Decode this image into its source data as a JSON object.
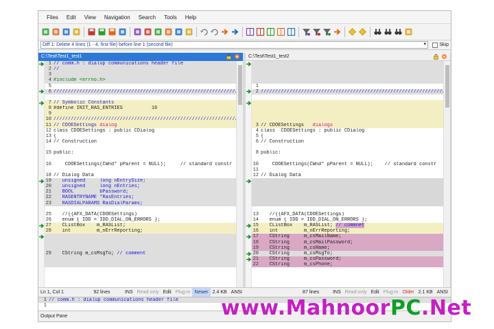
{
  "menu": [
    "Files",
    "Edit",
    "View",
    "Navigation",
    "Search",
    "Tools",
    "Help"
  ],
  "toolbar_icons": [
    "new-session-icon",
    "refresh-icon",
    "open-folder-icon",
    "open-file-icon",
    "sep",
    "save-icon",
    "save-left-icon",
    "save-right-icon",
    "find-icon",
    "sep",
    "edit-icon",
    "edit-right-icon",
    "text-icon",
    "copy-text-icon",
    "print-icon",
    "zoom-icon",
    "sep",
    "undo-icon",
    "redo-icon",
    "merge-right-icon",
    "merge-left-icon",
    "sep",
    "view-left-icon",
    "view-right-icon",
    "view-both-icon",
    "view-grid-icon",
    "view-diff-icon",
    "sep",
    "filter-icon",
    "filter-left-icon",
    "filter-right-icon",
    "up-arrow-icon",
    "sep",
    "first-diff-icon",
    "prev-diff-icon",
    "sep",
    "binoculars-icon",
    "binoculars-next-icon",
    "binoculars-prev-icon",
    "rescan-icon"
  ],
  "diff_bar": {
    "text": "Diff 1: Delete 4 lines (1 - 4, first file) before line 1 (second file)",
    "skip_label": "Skip"
  },
  "left_pane": {
    "path": "C:\\Test\\Test1_test1",
    "lines": [
      {
        "n": "1",
        "bg": "gray",
        "parts": [
          {
            "t": "// comm.h : dialup communications header file",
            "c": "cm"
          }
        ]
      },
      {
        "n": "2",
        "bg": "gray",
        "parts": [
          {
            "t": "//",
            "c": "cm"
          }
        ]
      },
      {
        "n": "3",
        "bg": "gray",
        "parts": [
          {
            "t": "",
            "c": ""
          }
        ]
      },
      {
        "n": "4",
        "bg": "gray",
        "parts": [
          {
            "t": "#include <errno.h>",
            "c": "grn"
          }
        ]
      },
      {
        "n": "5",
        "bg": "blank",
        "parts": [
          {
            "t": "",
            "c": ""
          }
        ]
      },
      {
        "n": "6",
        "bg": "gray",
        "parts": [
          {
            "t": "//////////////////////////////////////////////////////////////////",
            "c": "cm"
          }
        ]
      },
      {
        "n": "",
        "bg": "blank",
        "parts": [
          {
            "t": "",
            "c": ""
          }
        ]
      },
      {
        "n": "7",
        "bg": "changed",
        "parts": [
          {
            "t": "// Symbolic Constants",
            "c": "cm"
          }
        ]
      },
      {
        "n": "8",
        "bg": "changed",
        "parts": [
          {
            "t": "#define INIT_RAS_ENTRIES          16",
            "c": ""
          }
        ]
      },
      {
        "n": "9",
        "bg": "changed",
        "parts": [
          {
            "t": "",
            "c": ""
          }
        ]
      },
      {
        "n": "10",
        "bg": "changed",
        "parts": [
          {
            "t": "//////////////////////////////////////////////////////////////////",
            "c": "cm"
          }
        ]
      },
      {
        "n": "11",
        "bg": "changed",
        "parts": [
          {
            "t": "// CDOESettings ",
            "c": "cm"
          },
          {
            "t": "dialog",
            "c": "mag"
          }
        ]
      },
      {
        "n": "12",
        "bg": "blank",
        "parts": [
          {
            "t": "class CDOESettings : public CDialog",
            "c": ""
          }
        ]
      },
      {
        "n": "13",
        "bg": "blank",
        "parts": [
          {
            "t": "{",
            "c": ""
          }
        ]
      },
      {
        "n": "14",
        "bg": "blank",
        "parts": [
          {
            "t": "// Construction",
            "c": ""
          }
        ]
      },
      {
        "n": "",
        "bg": "blank",
        "parts": [
          {
            "t": "",
            "c": ""
          }
        ]
      },
      {
        "n": "15",
        "bg": "blank",
        "parts": [
          {
            "t": "public:",
            "c": ""
          }
        ]
      },
      {
        "n": "",
        "bg": "blank",
        "parts": [
          {
            "t": "",
            "c": ""
          }
        ]
      },
      {
        "n": "16",
        "bg": "blank",
        "parts": [
          {
            "t": "    CDOESettings(CWnd* pParent = NULL);     // standard constr",
            "c": ""
          }
        ]
      },
      {
        "n": "",
        "bg": "blank",
        "parts": [
          {
            "t": "",
            "c": ""
          }
        ]
      },
      {
        "n": "18",
        "bg": "blank",
        "parts": [
          {
            "t": "// Dialog Data",
            "c": ""
          }
        ]
      },
      {
        "n": "19",
        "bg": "gray",
        "parts": [
          {
            "t": "   unsigned     long nEntrySize;",
            "c": "kw"
          }
        ]
      },
      {
        "n": "20",
        "bg": "gray",
        "parts": [
          {
            "t": "   unsigned     long nEntries;",
            "c": "kw"
          }
        ]
      },
      {
        "n": "21",
        "bg": "gray",
        "parts": [
          {
            "t": "   BOOL         bPassword;",
            "c": "kw"
          }
        ]
      },
      {
        "n": "22",
        "bg": "gray",
        "parts": [
          {
            "t": "   RASENTRYNAME *RasEntries;",
            "c": "kw"
          }
        ]
      },
      {
        "n": "23",
        "bg": "gray",
        "parts": [
          {
            "t": "   RASDIALPARAMS RasDialParams;",
            "c": "kw"
          }
        ]
      },
      {
        "n": "",
        "bg": "blank",
        "parts": [
          {
            "t": "",
            "c": ""
          }
        ]
      },
      {
        "n": "25",
        "bg": "blank",
        "parts": [
          {
            "t": "   //{{AFX_DATA(CDOESettings)",
            "c": ""
          }
        ]
      },
      {
        "n": "26",
        "bg": "blank",
        "parts": [
          {
            "t": "   enum { IDD = IDD_DIAL_ON_ERRORS };",
            "c": ""
          }
        ]
      },
      {
        "n": "27",
        "bg": "changed",
        "parts": [
          {
            "t": "   CListBox    m_RASList;",
            "c": ""
          }
        ]
      },
      {
        "n": "28",
        "bg": "changed",
        "parts": [
          {
            "t": "   int         m_nErrReporting;",
            "c": ""
          }
        ]
      },
      {
        "n": "",
        "bg": "gray",
        "parts": [
          {
            "t": "",
            "c": ""
          }
        ]
      },
      {
        "n": "",
        "bg": "gray",
        "parts": [
          {
            "t": "",
            "c": ""
          }
        ]
      },
      {
        "n": "",
        "bg": "gray",
        "parts": [
          {
            "t": "",
            "c": ""
          }
        ]
      },
      {
        "n": "29",
        "bg": "gray",
        "parts": [
          {
            "t": "   CString m_csMsgTo; ",
            "c": ""
          },
          {
            "t": "// comment",
            "c": "cm"
          }
        ]
      },
      {
        "n": "",
        "bg": "gray",
        "parts": [
          {
            "t": "",
            "c": ""
          }
        ]
      },
      {
        "n": "",
        "bg": "gray",
        "parts": [
          {
            "t": "",
            "c": ""
          }
        ]
      }
    ]
  },
  "right_pane": {
    "path": "C:\\Test\\Test1_test2",
    "lines": [
      {
        "n": "",
        "bg": "gray",
        "parts": [
          {
            "t": "",
            "c": ""
          }
        ]
      },
      {
        "n": "",
        "bg": "gray",
        "parts": [
          {
            "t": "",
            "c": ""
          }
        ]
      },
      {
        "n": "",
        "bg": "gray",
        "parts": [
          {
            "t": "",
            "c": ""
          }
        ]
      },
      {
        "n": "",
        "bg": "gray",
        "parts": [
          {
            "t": "",
            "c": ""
          }
        ]
      },
      {
        "n": "1",
        "bg": "blank",
        "parts": [
          {
            "t": "",
            "c": ""
          }
        ]
      },
      {
        "n": "2",
        "bg": "gray",
        "parts": [
          {
            "t": "//////////////////////////////////////////////////////////////////",
            "c": "cm"
          }
        ]
      },
      {
        "n": "",
        "bg": "blank",
        "parts": [
          {
            "t": "",
            "c": ""
          }
        ]
      },
      {
        "n": "",
        "bg": "changed",
        "parts": [
          {
            "t": "",
            "c": ""
          }
        ]
      },
      {
        "n": "",
        "bg": "changed",
        "parts": [
          {
            "t": "",
            "c": ""
          }
        ]
      },
      {
        "n": "",
        "bg": "changed",
        "parts": [
          {
            "t": "",
            "c": ""
          }
        ]
      },
      {
        "n": "",
        "bg": "changed",
        "parts": [
          {
            "t": "",
            "c": ""
          }
        ]
      },
      {
        "n": "3",
        "bg": "changed",
        "parts": [
          {
            "t": "// CDOESettings   ",
            "c": ""
          },
          {
            "t": "dialogs",
            "c": "mag"
          }
        ]
      },
      {
        "n": "4",
        "bg": "blank",
        "parts": [
          {
            "t": "class  CDOESettings : public CDialog",
            "c": ""
          }
        ]
      },
      {
        "n": "5",
        "bg": "blank",
        "parts": [
          {
            "t": "{",
            "c": ""
          }
        ]
      },
      {
        "n": "6",
        "bg": "blank",
        "parts": [
          {
            "t": "// Construction",
            "c": ""
          }
        ]
      },
      {
        "n": "",
        "bg": "blank",
        "parts": [
          {
            "t": "",
            "c": ""
          }
        ]
      },
      {
        "n": "8",
        "bg": "blank",
        "parts": [
          {
            "t": "public:",
            "c": ""
          }
        ]
      },
      {
        "n": "",
        "bg": "blank",
        "parts": [
          {
            "t": "",
            "c": ""
          }
        ]
      },
      {
        "n": "10",
        "bg": "blank",
        "parts": [
          {
            "t": "    CDOESettings(CWnd* pParent = NULL);    // standard constr",
            "c": ""
          }
        ]
      },
      {
        "n": "11",
        "bg": "blank",
        "parts": [
          {
            "t": "",
            "c": ""
          }
        ]
      },
      {
        "n": "12",
        "bg": "blank",
        "parts": [
          {
            "t": "// Dialog Data",
            "c": ""
          }
        ]
      },
      {
        "n": "",
        "bg": "del",
        "parts": [
          {
            "t": "",
            "c": ""
          }
        ]
      },
      {
        "n": "",
        "bg": "del",
        "parts": [
          {
            "t": "",
            "c": ""
          }
        ]
      },
      {
        "n": "",
        "bg": "del",
        "parts": [
          {
            "t": "",
            "c": ""
          }
        ]
      },
      {
        "n": "",
        "bg": "del",
        "parts": [
          {
            "t": "",
            "c": ""
          }
        ]
      },
      {
        "n": "",
        "bg": "del",
        "parts": [
          {
            "t": "",
            "c": ""
          }
        ]
      },
      {
        "n": "",
        "bg": "blank",
        "parts": [
          {
            "t": "",
            "c": ""
          }
        ]
      },
      {
        "n": "13",
        "bg": "blank",
        "parts": [
          {
            "t": "   //{{AFX_DATA(CDOESettings)",
            "c": ""
          }
        ]
      },
      {
        "n": "14",
        "bg": "blank",
        "parts": [
          {
            "t": "   enum { IDD = IDD_DIAL_ON_ERRORS };",
            "c": ""
          }
        ]
      },
      {
        "n": "15",
        "bg": "changed",
        "parts": [
          {
            "t": "   CListBox    m_RASList; ",
            "c": ""
          },
          {
            "t": "// commnet",
            "c": "mod"
          }
        ]
      },
      {
        "n": "16",
        "bg": "changed",
        "parts": [
          {
            "t": "   int         m_nErrReporting;",
            "c": ""
          }
        ]
      },
      {
        "n": "17",
        "bg": "mod",
        "parts": [
          {
            "t": "   CString     m_csMailName;",
            "c": ""
          }
        ]
      },
      {
        "n": "18",
        "bg": "mod",
        "parts": [
          {
            "t": "   CString     m_csMailPassword;",
            "c": ""
          }
        ]
      },
      {
        "n": "19",
        "bg": "mod",
        "parts": [
          {
            "t": "   CString     m_csName;",
            "c": ""
          }
        ]
      },
      {
        "n": "20",
        "bg": "gray",
        "parts": [
          {
            "t": "   CString     m_csMsgTo;",
            "c": ""
          }
        ]
      },
      {
        "n": "21",
        "bg": "mod",
        "parts": [
          {
            "t": "   CString     m_csPassword;",
            "c": ""
          }
        ]
      },
      {
        "n": "22",
        "bg": "mod",
        "parts": [
          {
            "t": "   CString     m_csPhone;",
            "c": ""
          }
        ]
      }
    ]
  },
  "status_left": {
    "position": "Ln 1, Col 1",
    "lines": "92 lines",
    "ins": "INS",
    "readonly": "Read-only",
    "edit": "Edit",
    "plugin": "Plug-in",
    "age": "Newer",
    "size": "2.4 KB",
    "encoding": "ANSI"
  },
  "status_right": {
    "lines": "87 lines",
    "ins": "INS",
    "readonly": "Read-only",
    "edit": "Edit",
    "plugin": "Plug-in",
    "age": "Older",
    "size": "2.1 KB",
    "encoding": "ANSI"
  },
  "diff_pane_lines": [
    {
      "n": "1",
      "text": "// comm.h : dialup communications header file"
    },
    {
      "n": "1",
      "text": ""
    }
  ],
  "output_pane_label": "Output Pane",
  "watermark": {
    "part_a": "www.",
    "part_b": "Mahnoor",
    "part_c": "PC",
    "part_d": ".Net"
  },
  "colors": {
    "accent": "#2a79d8",
    "changed": "#f4efc3",
    "removed": "#dedede",
    "modified": "#d9a8c5",
    "comment": "#1a1ad4",
    "keyword_magenta": "#c8178a"
  }
}
